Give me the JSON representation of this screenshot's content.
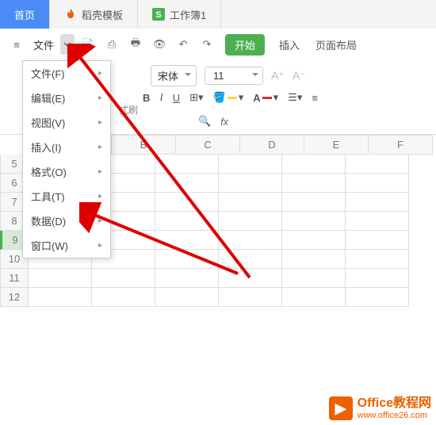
{
  "tabs": {
    "home": "首页",
    "template": "稻壳模板",
    "workbook": "工作簿1"
  },
  "toolbar": {
    "file": "文件",
    "start": "开始",
    "insert": "插入",
    "page_layout": "页面布局"
  },
  "brush": "式刷",
  "font": {
    "name": "宋体",
    "size": "11"
  },
  "fx": "fx",
  "menu": {
    "file": "文件(F)",
    "edit": "编辑(E)",
    "view": "视图(V)",
    "insert": "插入(I)",
    "format": "格式(O)",
    "tools": "工具(T)",
    "data": "数据(D)",
    "window": "窗口(W)"
  },
  "cols": {
    "b": "B",
    "c": "C",
    "d": "D",
    "e": "E",
    "f": "F"
  },
  "rows": {
    "r5": "5",
    "r6": "6",
    "r7": "7",
    "r8": "8",
    "r9": "9",
    "r10": "10",
    "r11": "11",
    "r12": "12"
  },
  "watermark": {
    "title": "Office教程网",
    "url": "www.office26.com"
  }
}
